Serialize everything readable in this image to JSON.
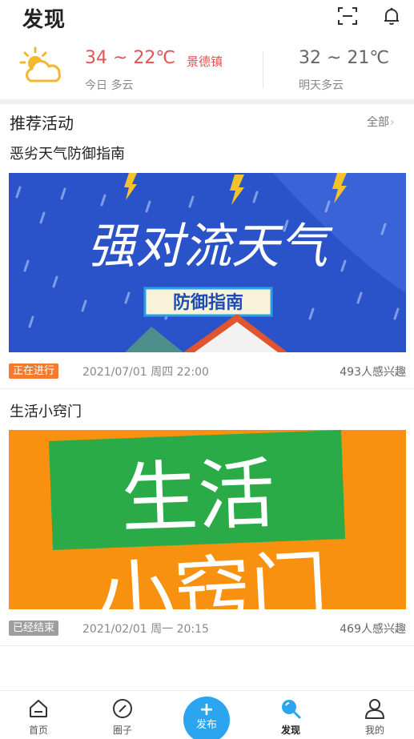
{
  "header": {
    "title": "发现",
    "scan_icon": "scan-icon",
    "bell_icon": "bell-icon"
  },
  "weather": {
    "icon": "partly-cloudy-icon",
    "today_temp": "34 ~ 22℃",
    "city": "景德镇",
    "today_desc": "今日 多云",
    "tomorrow_temp": "32 ~ 21℃",
    "tomorrow_desc": "明天多云"
  },
  "section": {
    "title": "推荐活动",
    "all_label": "全部",
    "all_chevron": "›"
  },
  "activities": [
    {
      "title": "恶劣天气防御指南",
      "banner_title": "强对流天气",
      "banner_subtitle": "防御指南",
      "status": "正在进行",
      "date": "2021/07/01 周四 22:00",
      "interest_count": "493",
      "interest_label": "人感兴趣"
    },
    {
      "title": "生活小窍门",
      "banner_line1": "生活",
      "banner_line2": "小窍门",
      "status": "已经结束",
      "date": "2021/02/01 周一 20:15",
      "interest_count": "469",
      "interest_label": "人感兴趣"
    }
  ],
  "colors": {
    "accent": "#2ca5f0",
    "hot": "#e55353",
    "active_badge": "#f47a2d",
    "ended_badge": "#9e9e9e",
    "banner1_bg": "#2b53c9",
    "banner2_bg": "#f7910f",
    "banner2_green": "#2bab48"
  },
  "tabbar": {
    "home": "首页",
    "circle": "圈子",
    "publish_plus": "+",
    "publish": "发布",
    "discover": "发现",
    "mine": "我的"
  }
}
